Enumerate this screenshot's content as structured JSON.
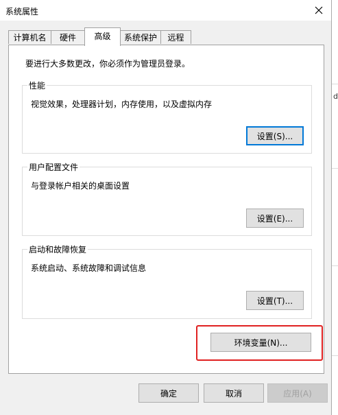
{
  "window": {
    "title": "系统属性",
    "close_icon": "close-icon"
  },
  "tabs": [
    {
      "label": "计算机名"
    },
    {
      "label": "硬件"
    },
    {
      "label": "高级",
      "active": true
    },
    {
      "label": "系统保护"
    },
    {
      "label": "远程"
    }
  ],
  "advanced": {
    "intro": "要进行大多数更改，你必须作为管理员登录。",
    "performance": {
      "title": "性能",
      "description": "视觉效果，处理器计划，内存使用，以及虚拟内存",
      "button": "设置(S)..."
    },
    "user_profiles": {
      "title": "用户配置文件",
      "description": "与登录帐户相关的桌面设置",
      "button": "设置(E)..."
    },
    "startup_recovery": {
      "title": "启动和故障恢复",
      "description": "系统启动、系统故障和调试信息",
      "button": "设置(T)..."
    },
    "env_button": "环境变量(N)..."
  },
  "footer": {
    "ok": "确定",
    "cancel": "取消",
    "apply": "应用(A)"
  },
  "background_fragment": "d",
  "colors": {
    "highlight": "#e02020",
    "focus": "#0078d7"
  }
}
